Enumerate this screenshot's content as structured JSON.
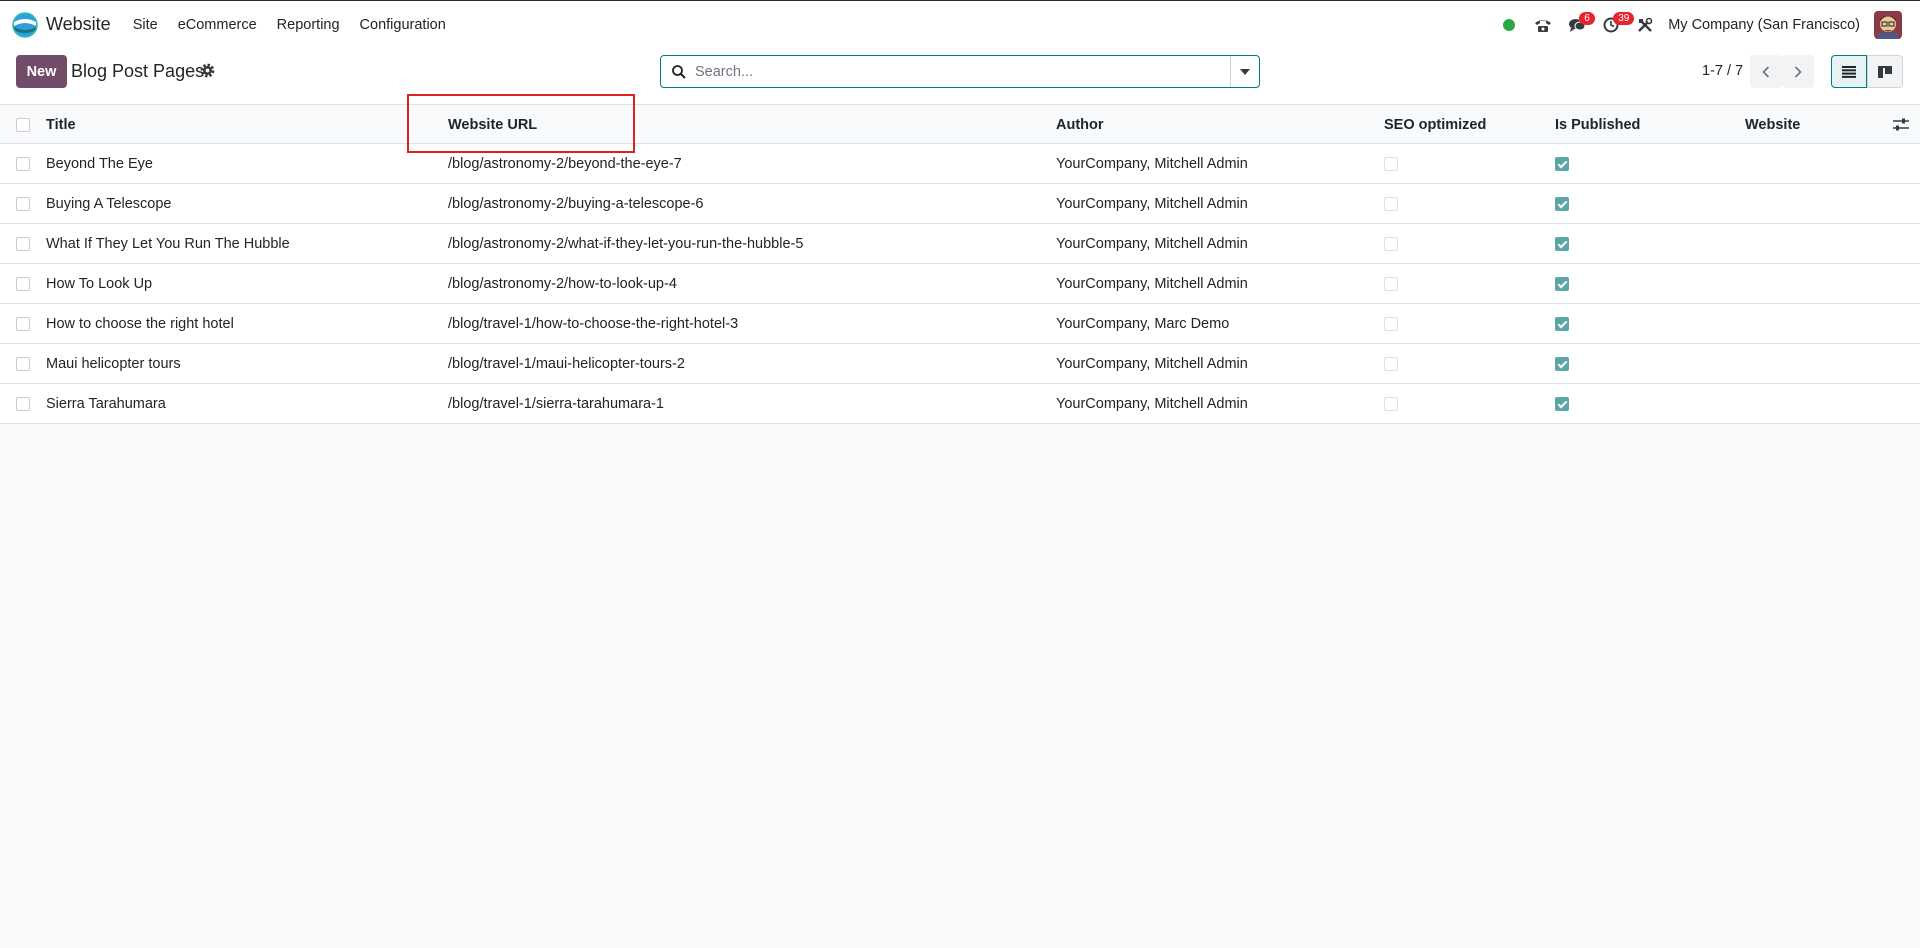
{
  "app": {
    "name": "Website",
    "menu": [
      "Site",
      "eCommerce",
      "Reporting",
      "Configuration"
    ]
  },
  "systray": {
    "messages_badge": "6",
    "activities_badge": "39",
    "company": "My Company (San Francisco)",
    "status_color": "#28a745"
  },
  "control": {
    "new_label": "New",
    "title": "Blog Post Pages",
    "search_placeholder": "Search...",
    "pager": "1-7 / 7"
  },
  "table": {
    "columns": [
      "Title",
      "Website URL",
      "Author",
      "SEO optimized",
      "Is Published",
      "Website"
    ],
    "rows": [
      {
        "title": "Beyond The Eye",
        "url": "/blog/astronomy-2/beyond-the-eye-7",
        "author": "YourCompany, Mitchell Admin",
        "seo": false,
        "published": true,
        "website": ""
      },
      {
        "title": "Buying A Telescope",
        "url": "/blog/astronomy-2/buying-a-telescope-6",
        "author": "YourCompany, Mitchell Admin",
        "seo": false,
        "published": true,
        "website": ""
      },
      {
        "title": "What If They Let You Run The Hubble",
        "url": "/blog/astronomy-2/what-if-they-let-you-run-the-hubble-5",
        "author": "YourCompany, Mitchell Admin",
        "seo": false,
        "published": true,
        "website": ""
      },
      {
        "title": "How To Look Up",
        "url": "/blog/astronomy-2/how-to-look-up-4",
        "author": "YourCompany, Mitchell Admin",
        "seo": false,
        "published": true,
        "website": ""
      },
      {
        "title": "How to choose the right hotel",
        "url": "/blog/travel-1/how-to-choose-the-right-hotel-3",
        "author": "YourCompany, Marc Demo",
        "seo": false,
        "published": true,
        "website": ""
      },
      {
        "title": "Maui helicopter tours",
        "url": "/blog/travel-1/maui-helicopter-tours-2",
        "author": "YourCompany, Mitchell Admin",
        "seo": false,
        "published": true,
        "website": ""
      },
      {
        "title": "Sierra Tarahumara",
        "url": "/blog/travel-1/sierra-tarahumara-1",
        "author": "YourCompany, Mitchell Admin",
        "seo": false,
        "published": true,
        "website": ""
      }
    ]
  },
  "colors": {
    "brand": "#714b67",
    "accent": "#017e84",
    "checkbox_checked": "#5ea6a9",
    "badge": "#e6232f",
    "highlight": "#e02020"
  },
  "icons": [
    "website-logo-icon",
    "phone-icon",
    "chat-icon",
    "clock-icon",
    "tools-icon",
    "gear-icon",
    "search-icon",
    "caret-down-icon",
    "chevron-left-icon",
    "chevron-right-icon",
    "list-view-icon",
    "kanban-view-icon",
    "optional-columns-icon"
  ]
}
